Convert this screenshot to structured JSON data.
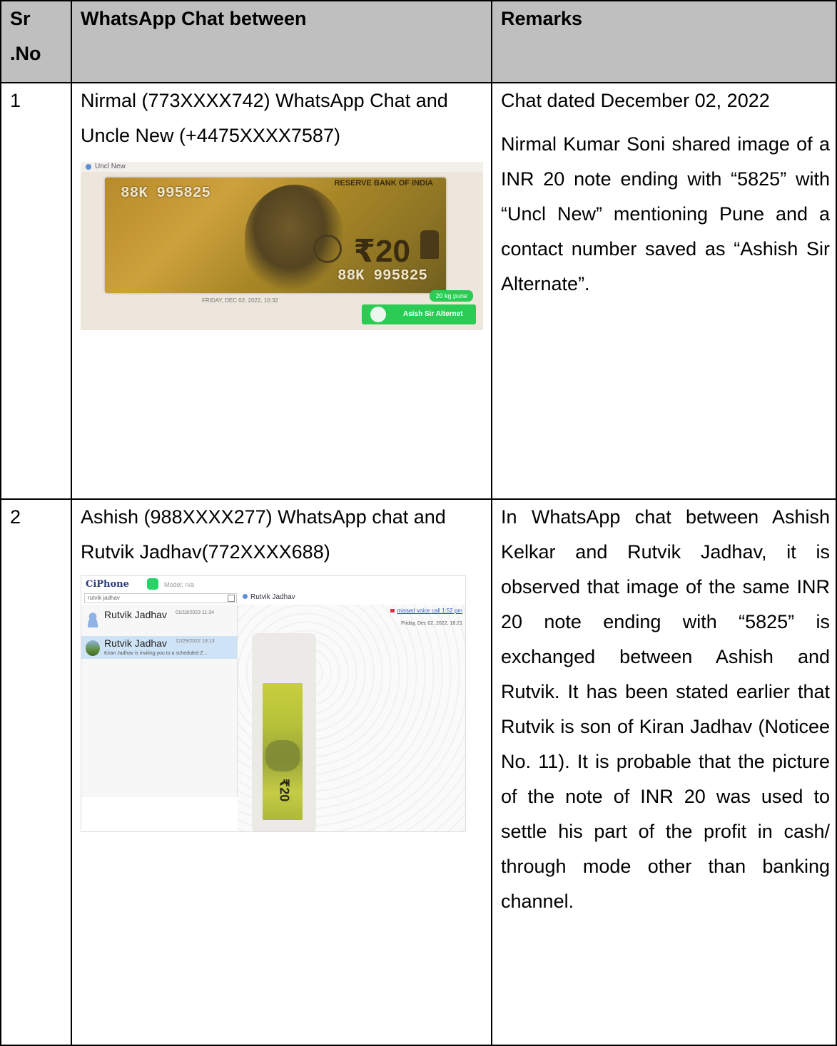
{
  "header": {
    "col1": "Sr .No",
    "col2": "WhatsApp Chat between",
    "col3": "Remarks"
  },
  "rows": [
    {
      "sr": "1",
      "chat_title": "Nirmal (773XXXX742) WhatsApp Chat and Uncle New (+4475XXXX7587)",
      "remark_date": "Chat dated December 02, 2022",
      "remark": "Nirmal Kumar Soni shared image of a INR 20 note ending with “5825” with “Uncl New” mentioning Pune and a contact number saved as “Ashish Sir Alternate”.",
      "screenshot": {
        "contact_header": "Uncl New",
        "serial_top": "88K 995825",
        "serial_bottom": "88K 995825",
        "denomination": "₹20",
        "bank_text": "RESERVE BANK OF INDIA",
        "timestamp": "FRIDAY, DEC 02, 2022, 10:32",
        "message": "20 kg pune",
        "contact_card": "Asish Sir Alternet",
        "accent_color": "#2bcc54"
      }
    },
    {
      "sr": "2",
      "chat_title": "Ashish (988XXXX277) WhatsApp chat and Rutvik Jadhav(772XXXX688)",
      "remark": "In WhatsApp chat between Ashish Kelkar and Rutvik Jadhav, it is observed that image of the same INR 20 note ending with “5825” is exchanged between Ashish and Rutvik. It has been stated earlier that Rutvik is son of Kiran Jadhav (Noticee No. 11). It is probable that the picture of the note of INR 20 was used to settle his part of the profit in cash/ through mode other than banking channel.",
      "screenshot": {
        "app_name": "CiPhone",
        "model": "Model: n/a",
        "search_text": "rutvik jadhav",
        "chat_header": "Rutvik Jadhav",
        "contacts": [
          {
            "name": "Rutvik Jadhav",
            "date": "01/18/2023 11:34",
            "preview": ""
          },
          {
            "name": "Rutvik Jadhav",
            "date": "12/29/2022 19:13",
            "preview": "Kiran Jadhav is inviting you to a scheduled Z..."
          }
        ],
        "missed_call": "missed voice call 1:52 pm",
        "day_stamp": "Friday, Dec 02, 2022, 18:21",
        "denomination": "₹20",
        "accent_color": "#25d366"
      }
    }
  ]
}
